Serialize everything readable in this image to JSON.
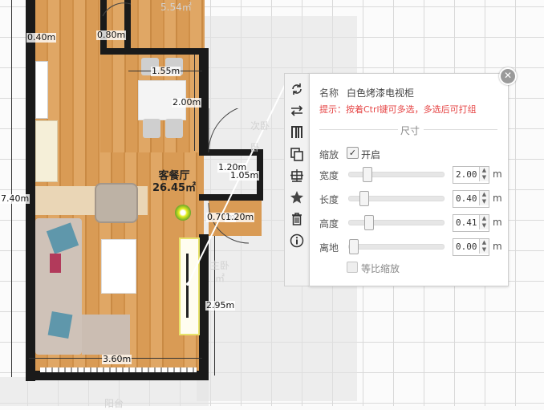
{
  "plan": {
    "room_name": "客餐厅",
    "room_area": "26.45㎡",
    "dimensions": [
      "0.40m",
      "0.80m",
      "1.55m",
      "2.00m",
      "1.20m",
      "1.05m",
      "0.70m",
      "1.20m",
      "7.40m",
      "2.95m",
      "3.60m"
    ],
    "ghost_labels": [
      "5.54㎡",
      "次卧",
      "卧",
      "主卧",
      "㎡",
      "阳台"
    ]
  },
  "toolbar": {
    "icons": [
      "rotate-icon",
      "mirror-icon",
      "align-icon",
      "copy-icon",
      "center-icon",
      "favorite-icon",
      "delete-icon",
      "info-icon"
    ]
  },
  "panel": {
    "name_label": "名称",
    "name_value": "白色烤漆电视柜",
    "hint": "提示：按着Ctrl键可多选，多选后可打组",
    "section_title": "尺寸",
    "scale_label": "缩放",
    "scale_toggle_label": "开启",
    "scale_enabled": true,
    "fields": [
      {
        "label": "宽度",
        "value": "2.00",
        "unit": "m",
        "slider_fraction": 0.16
      },
      {
        "label": "长度",
        "value": "0.40",
        "unit": "m",
        "slider_fraction": 0.12
      },
      {
        "label": "高度",
        "value": "0.41",
        "unit": "m",
        "slider_fraction": 0.18
      },
      {
        "label": "离地",
        "value": "0.00",
        "unit": "m",
        "slider_fraction": 0.0
      }
    ],
    "proportional_label": "等比缩放",
    "proportional_enabled": false
  }
}
